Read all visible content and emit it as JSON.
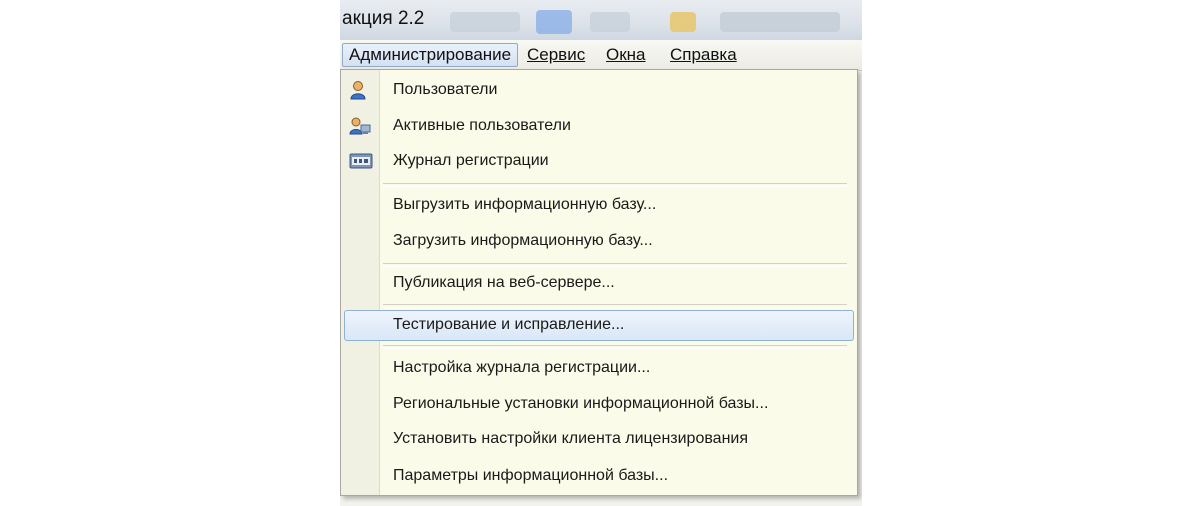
{
  "window": {
    "title_fragment": "акция 2.2"
  },
  "menubar": {
    "items": [
      {
        "label": "Администрирование",
        "active": true
      },
      {
        "label": "Сервис"
      },
      {
        "label": "Окна"
      },
      {
        "label": "Справка"
      }
    ]
  },
  "dropdown": {
    "items": [
      {
        "label": "Пользователи",
        "icon": "user-icon"
      },
      {
        "label": "Активные пользователи",
        "icon": "active-users-icon"
      },
      {
        "label": "Журнал регистрации",
        "icon": "event-log-icon"
      },
      {
        "label": "Выгрузить информационную базу..."
      },
      {
        "label": "Загрузить информационную базу..."
      },
      {
        "label": "Публикация на веб-сервере..."
      },
      {
        "label": "Тестирование и исправление...",
        "highlighted": true
      },
      {
        "label": "Настройка журнала регистрации..."
      },
      {
        "label": "Региональные установки информационной базы..."
      },
      {
        "label": "Установить настройки клиента лицензирования"
      },
      {
        "label": "Параметры информационной базы..."
      }
    ]
  },
  "colors": {
    "menu_background": "#fbfbea",
    "highlight_border": "#8fb0d9",
    "highlight_fill": "#d9e7f7"
  }
}
